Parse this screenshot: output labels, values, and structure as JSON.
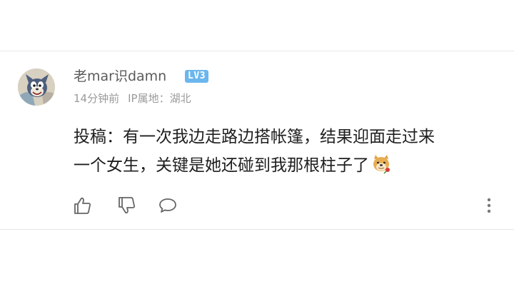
{
  "comment": {
    "username": "老mar识damn",
    "level_badge": "LV3",
    "time_ago": "14分钟前",
    "ip_location": "IP属地：湖北",
    "content_line1": "投稿：有一次我边走路边搭帐篷，结果迎面走过来",
    "content_line2": "一个女生，关键是她还碰到我那根柱子了",
    "badge_color": "#6cb6ee"
  },
  "icons": {
    "avatar": "tom-cat-avatar",
    "emoji": "doge-rose-emoji",
    "like": "thumbs-up-icon",
    "dislike": "thumbs-down-icon",
    "reply": "speech-bubble-icon",
    "more": "vertical-ellipsis-icon"
  }
}
